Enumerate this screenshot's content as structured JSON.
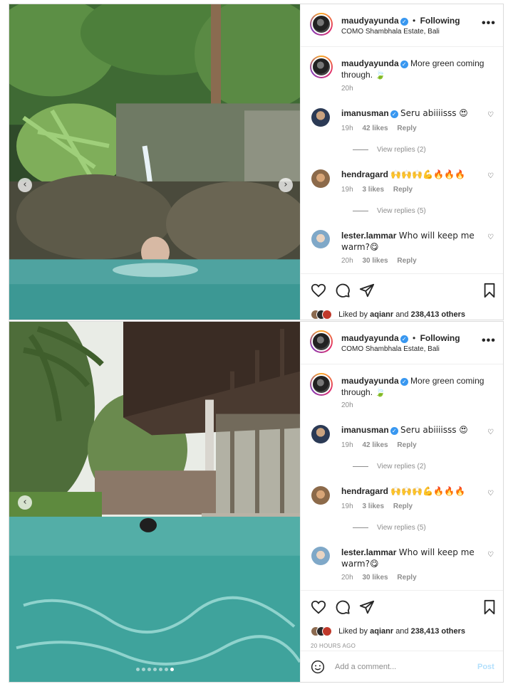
{
  "post": {
    "username": "maudyayunda",
    "follow_label": "Following",
    "location": "COMO Shambhala Estate, Bali",
    "more_label": "•••",
    "caption": "More green coming through. 🍃",
    "caption_time": "20h",
    "liked_by_prefix": "Liked by",
    "liked_by_user": "aqianr",
    "liked_by_and": "and",
    "liked_by_count": "238,413 others",
    "timestamp": "20 HOURS AGO",
    "add_comment_placeholder": "Add a comment...",
    "post_label": "Post"
  },
  "comments": [
    {
      "username": "imanusman",
      "verified": true,
      "text": "Seru abiiiisss 😍",
      "time": "19h",
      "likes": "42 likes",
      "reply": "Reply",
      "view_replies": "View replies (2)"
    },
    {
      "username": "hendragard",
      "verified": false,
      "text": "🙌🙌🙌💪🔥🔥🔥",
      "time": "19h",
      "likes": "3 likes",
      "reply": "Reply",
      "view_replies": "View replies (5)"
    },
    {
      "username": "lester.lammar",
      "verified": false,
      "text": "Who will keep me warm?😋",
      "time": "20h",
      "likes": "30 likes",
      "reply": "Reply"
    }
  ],
  "carousel": {
    "dots": 7,
    "active_dot": 6
  },
  "colors": {
    "verified": "#3897f0",
    "link_blue": "#b2dffc",
    "muted": "#8e8e8e",
    "border": "#dbdbdb"
  },
  "icons": [
    "heart-icon",
    "comment-icon",
    "share-icon",
    "bookmark-icon",
    "emoji-icon",
    "more-icon",
    "verified-icon"
  ]
}
